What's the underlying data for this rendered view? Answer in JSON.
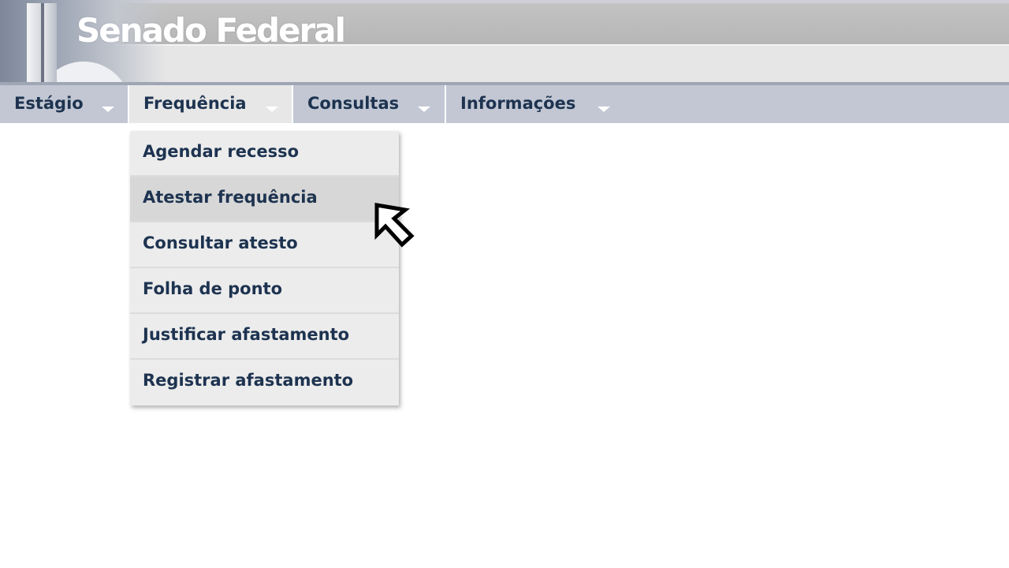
{
  "header": {
    "title": "Senado Federal",
    "logo_icon": "congress-building-icon"
  },
  "nav": {
    "items": [
      {
        "label": "Estágio",
        "active": false
      },
      {
        "label": "Frequência",
        "active": true
      },
      {
        "label": "Consultas",
        "active": false
      },
      {
        "label": "Informações",
        "active": false
      }
    ],
    "arrow_icon": "dropdown-arrow-icon"
  },
  "dropdown": {
    "items": [
      {
        "label": "Agendar recesso"
      },
      {
        "label": "Atestar frequência",
        "hovered": true
      },
      {
        "label": "Consultar atesto"
      },
      {
        "label": "Folha de ponto"
      },
      {
        "label": "Justificar afastamento"
      },
      {
        "label": "Registrar afastamento"
      }
    ]
  },
  "cursor": {
    "icon": "mouse-pointer-icon"
  },
  "colors": {
    "nav_bg": "#c2c7d3",
    "nav_active_bg": "#e7e7e7",
    "menu_bg": "#ececec",
    "menu_hover_bg": "#d7d7d7",
    "text": "#1d3350"
  }
}
